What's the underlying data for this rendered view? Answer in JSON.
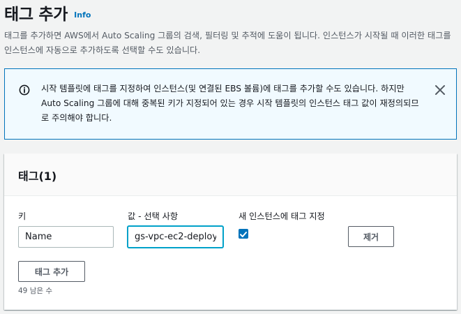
{
  "header": {
    "title": "태그 추가",
    "info_link": "Info"
  },
  "description": "태그를 추가하면 AWS에서 Auto Scaling 그룹의 검색, 필터링 및 추적에 도움이 됩니다. 인스턴스가 시작될 때 이러한 태그를 인스턴스에 자동으로 추가하도록 선택할 수도 있습니다.",
  "alert": {
    "icon": "info-circle-icon",
    "text": "시작 템플릿에 태그를 지정하여 인스턴스(및 연결된 EBS 볼륨)에 태그를 추가할 수도 있습니다. 하지만 Auto Scaling 그룹에 대해 중복된 키가 지정되어 있는 경우 시작 템플릿의 인스턴스 태그 값이 재정의되므로 주의해야 합니다.",
    "close_icon": "close-icon"
  },
  "tags_panel": {
    "title": "태그(1)",
    "columns": {
      "key": "키",
      "value": "값 - 선택 사항",
      "tag_new_instances": "새 인스턴스에 태그 지정"
    },
    "rows": [
      {
        "key": "Name",
        "value": "gs-vpc-ec2-deploy",
        "tag_new_instances": true,
        "remove_label": "제거"
      }
    ],
    "add_tag_label": "태그 추가",
    "remaining_text": "49 남은 수"
  },
  "colors": {
    "accent": "#0073bb",
    "focus": "#00a1c9",
    "alert_bg": "#f1faff",
    "page_bg": "#f2f3f3"
  }
}
